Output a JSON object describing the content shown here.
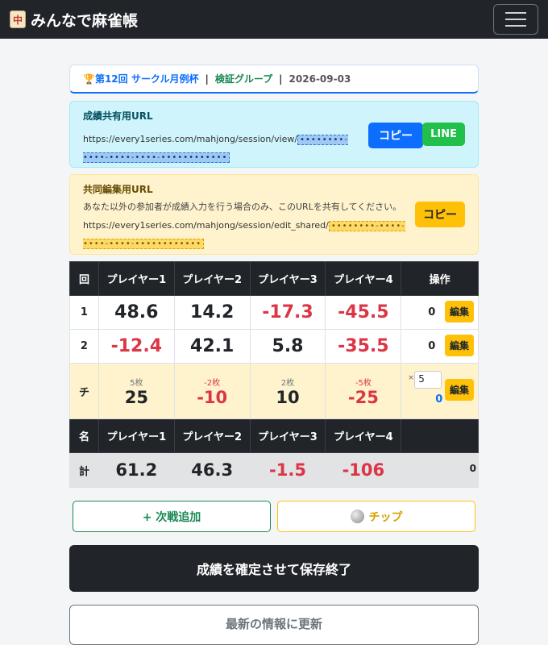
{
  "app": {
    "title": "みんなで麻雀帳",
    "tile_glyph": "中"
  },
  "session": {
    "trophy": "🏆",
    "name": "第12回 サークル月例杯",
    "separator": "|",
    "group": "検証グループ",
    "date": "2026-09-03"
  },
  "share": {
    "heading": "成績共有用URL",
    "url": "https://every1series.com/mahjong/session/view/",
    "masked": "••••••••-••••-••••-••••-••••••••••••",
    "copy_label": "コピー",
    "line_label": "LINE"
  },
  "edit": {
    "heading": "共同編集用URL",
    "description": "あなた以外の参加者が成績入力を行う場合のみ、このURLを共有してください。",
    "url": "https://every1series.com/mahjong/session/edit_shared/",
    "masked": "••••••••-••••-••••-••••-••••••••••••",
    "copy_label": "コピー"
  },
  "table": {
    "headers": [
      "回",
      "プレイヤー1",
      "プレイヤー2",
      "プレイヤー3",
      "プレイヤー4",
      "操作"
    ],
    "rounds": [
      {
        "label": "1",
        "scores": [
          "48.6",
          "14.2",
          "-17.3",
          "-45.5"
        ],
        "op": "0",
        "edit": "編集"
      },
      {
        "label": "2",
        "scores": [
          "-12.4",
          "42.1",
          "5.8",
          "-35.5"
        ],
        "op": "0",
        "edit": "編集"
      }
    ],
    "chip": {
      "label": "チ",
      "counts": [
        "5枚",
        "-2枚",
        "2枚",
        "-5枚"
      ],
      "values": [
        "25",
        "-10",
        "10",
        "-25"
      ],
      "mult_symbol": "×",
      "rate": "5",
      "sum": "0",
      "edit": "編集"
    },
    "name_row": {
      "label": "名",
      "names": [
        "プレイヤー1",
        "プレイヤー2",
        "プレイヤー3",
        "プレイヤー4"
      ]
    },
    "total": {
      "label": "計",
      "scores": [
        "61.2",
        "46.3",
        "-1.5",
        "-106"
      ],
      "sum": "0"
    }
  },
  "buttons": {
    "add_round": "+ 次戦追加",
    "chip": "チップ",
    "save": "成績を確定させて保存終了",
    "refresh": "最新の情報に更新"
  },
  "colors": {
    "negative": "#dc3545",
    "primary": "#0d6efd",
    "success": "#198754",
    "warning": "#ffc107",
    "dark": "#212529"
  }
}
